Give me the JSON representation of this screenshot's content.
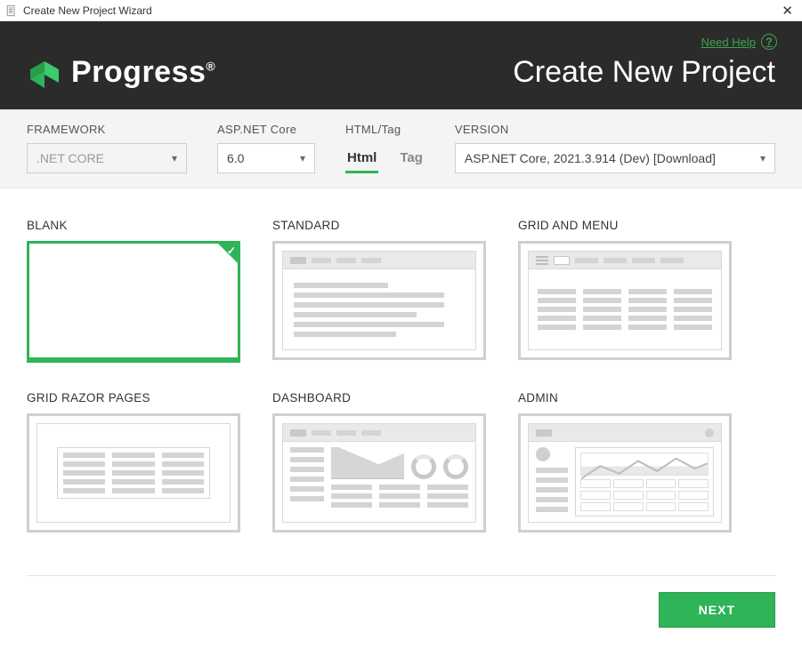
{
  "window": {
    "title": "Create New Project Wizard"
  },
  "header": {
    "help_label": "Need Help",
    "brand": "Progress",
    "page_title": "Create New Project"
  },
  "filters": {
    "framework_label": "FRAMEWORK",
    "framework_value": ".NET CORE",
    "aspnet_label": "ASP.NET Core",
    "aspnet_value": "6.0",
    "htmltag_label": "HTML/Tag",
    "tabs": {
      "html": "Html",
      "tag": "Tag",
      "active": "html"
    },
    "version_label": "VERSION",
    "version_value": "ASP.NET Core, 2021.3.914 (Dev) [Download]"
  },
  "templates": [
    {
      "id": "blank",
      "label": "BLANK",
      "selected": true
    },
    {
      "id": "standard",
      "label": "STANDARD",
      "selected": false
    },
    {
      "id": "grid-menu",
      "label": "GRID AND MENU",
      "selected": false
    },
    {
      "id": "grid-razor",
      "label": "GRID RAZOR PAGES",
      "selected": false
    },
    {
      "id": "dashboard",
      "label": "DASHBOARD",
      "selected": false
    },
    {
      "id": "admin",
      "label": "ADMIN",
      "selected": false
    }
  ],
  "footer": {
    "next_label": "NEXT"
  }
}
